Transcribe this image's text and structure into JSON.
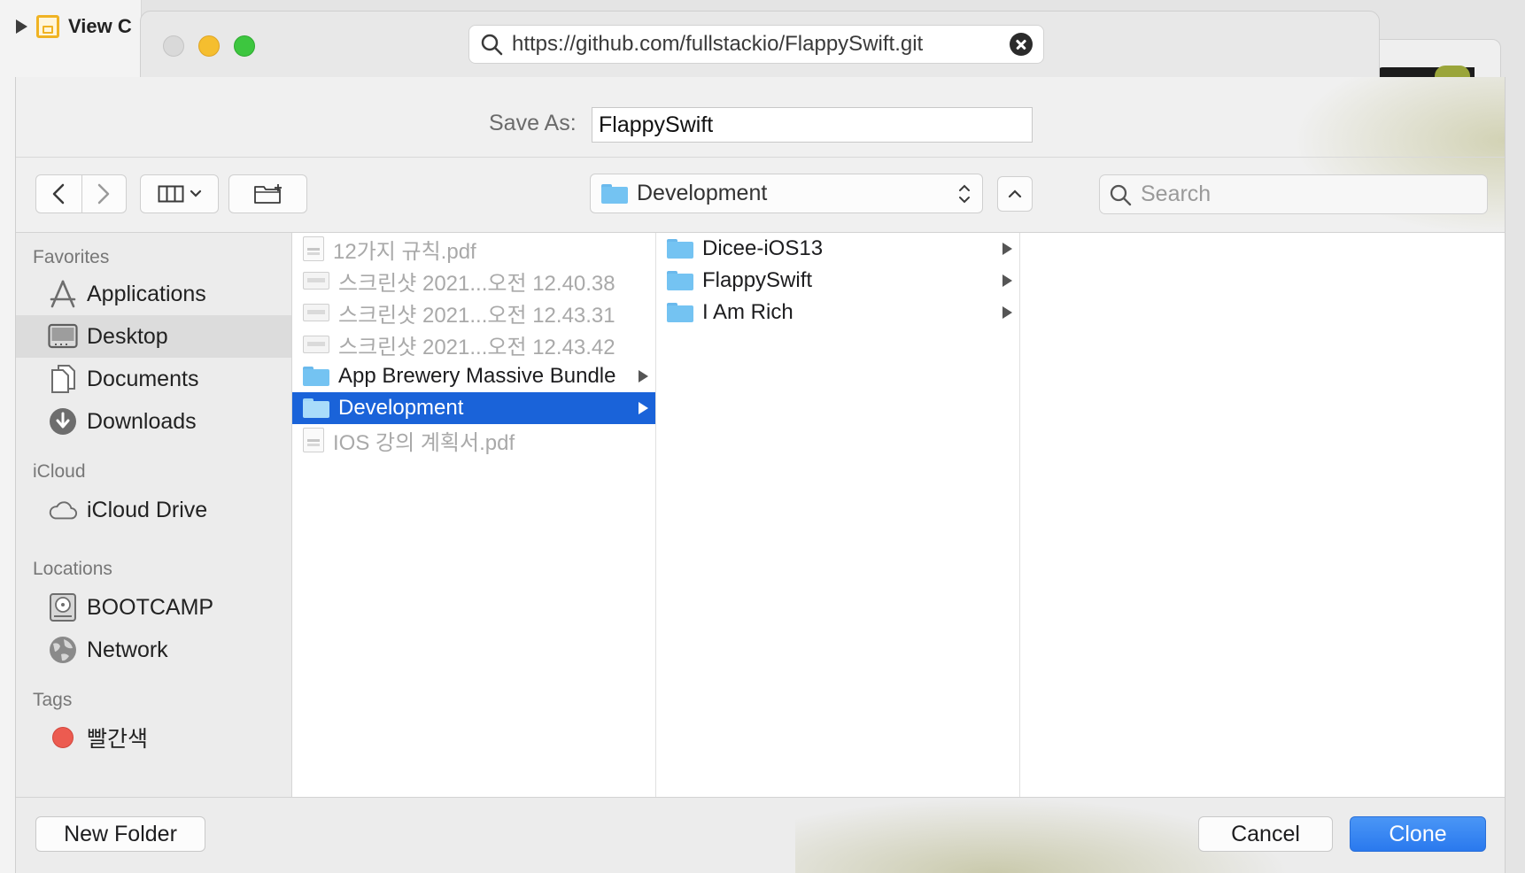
{
  "background": {
    "project_item_label": "View C"
  },
  "window": {
    "url": "https://github.com/fullstackio/FlappySwift.git"
  },
  "save_dialog": {
    "save_as_label": "Save As:",
    "save_as_value": "FlappySwift",
    "current_folder": "Development",
    "search_placeholder": "Search"
  },
  "sidebar": {
    "favorites_header": "Favorites",
    "favorites": [
      {
        "label": "Applications",
        "icon": "applications-icon"
      },
      {
        "label": "Desktop",
        "icon": "desktop-icon",
        "selected": true
      },
      {
        "label": "Documents",
        "icon": "documents-icon"
      },
      {
        "label": "Downloads",
        "icon": "downloads-icon"
      }
    ],
    "icloud_header": "iCloud",
    "icloud": [
      {
        "label": "iCloud Drive",
        "icon": "cloud-icon"
      }
    ],
    "locations_header": "Locations",
    "locations": [
      {
        "label": "BOOTCAMP",
        "icon": "disk-icon"
      },
      {
        "label": "Network",
        "icon": "globe-icon"
      }
    ],
    "tags_header": "Tags",
    "tags": [
      {
        "label": "빨간색",
        "color": "#ec5b50"
      }
    ]
  },
  "columns": {
    "desktop_items": [
      {
        "label": "12가지 규칙.pdf",
        "kind": "pdf",
        "dimmed": true
      },
      {
        "label": "스크린샷 2021...오전 12.40.38",
        "kind": "image",
        "dimmed": true
      },
      {
        "label": "스크린샷 2021...오전 12.43.31",
        "kind": "image",
        "dimmed": true
      },
      {
        "label": "스크린샷 2021...오전 12.43.42",
        "kind": "image",
        "dimmed": true
      },
      {
        "label": "App Brewery Massive Bundle",
        "kind": "folder",
        "dimmed": false
      },
      {
        "label": "Development",
        "kind": "folder",
        "dimmed": false,
        "selected": true
      },
      {
        "label": "IOS 강의 계획서.pdf",
        "kind": "pdf",
        "dimmed": true
      }
    ],
    "development_items": [
      {
        "label": "Dicee-iOS13",
        "kind": "folder"
      },
      {
        "label": "FlappySwift",
        "kind": "folder"
      },
      {
        "label": "I Am Rich",
        "kind": "folder"
      }
    ]
  },
  "buttons": {
    "new_folder": "New Folder",
    "cancel": "Cancel",
    "clone": "Clone"
  },
  "colors": {
    "selection_blue": "#1a63d9",
    "primary_button": "#2a79ee",
    "folder_blue": "#74c3f2",
    "tag_red": "#ec5b50"
  }
}
